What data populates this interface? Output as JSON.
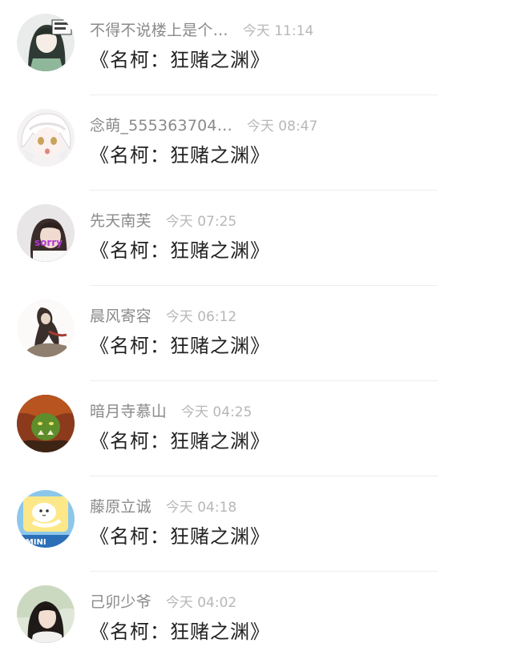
{
  "comments": [
    {
      "username": "不得不说楼上是个…",
      "time": "今天 11:14",
      "content": "《名柯：狂赌之渊》",
      "avatar": "anime-girl-green-hair-avatar"
    },
    {
      "username": "念萌_555363704…",
      "time": "今天 08:47",
      "content": "《名柯：狂赌之渊》",
      "avatar": "white-hair-anime-avatar"
    },
    {
      "username": "先天南芙",
      "time": "今天 07:25",
      "content": "《名柯：狂赌之渊》",
      "avatar": "girl-sorry-text-avatar"
    },
    {
      "username": "晨风寄容",
      "time": "今天 06:12",
      "content": "《名柯：狂赌之渊》",
      "avatar": "ink-painting-figure-avatar"
    },
    {
      "username": "暗月寺慕山",
      "time": "今天 04:25",
      "content": "《名柯：狂赌之渊》",
      "avatar": "orc-warrior-avatar"
    },
    {
      "username": "藤原立诚",
      "time": "今天 04:18",
      "content": "《名柯：狂赌之渊》",
      "avatar": "cartoon-gemini-avatar"
    },
    {
      "username": "己卯少爷",
      "time": "今天 04:02",
      "content": "《名柯：狂赌之渊》",
      "avatar": "girl-photo-avatar"
    }
  ],
  "colors": {
    "username": "#8a8a8a",
    "time": "#b7b7b7",
    "content": "#222222",
    "divider": "#ededed"
  }
}
